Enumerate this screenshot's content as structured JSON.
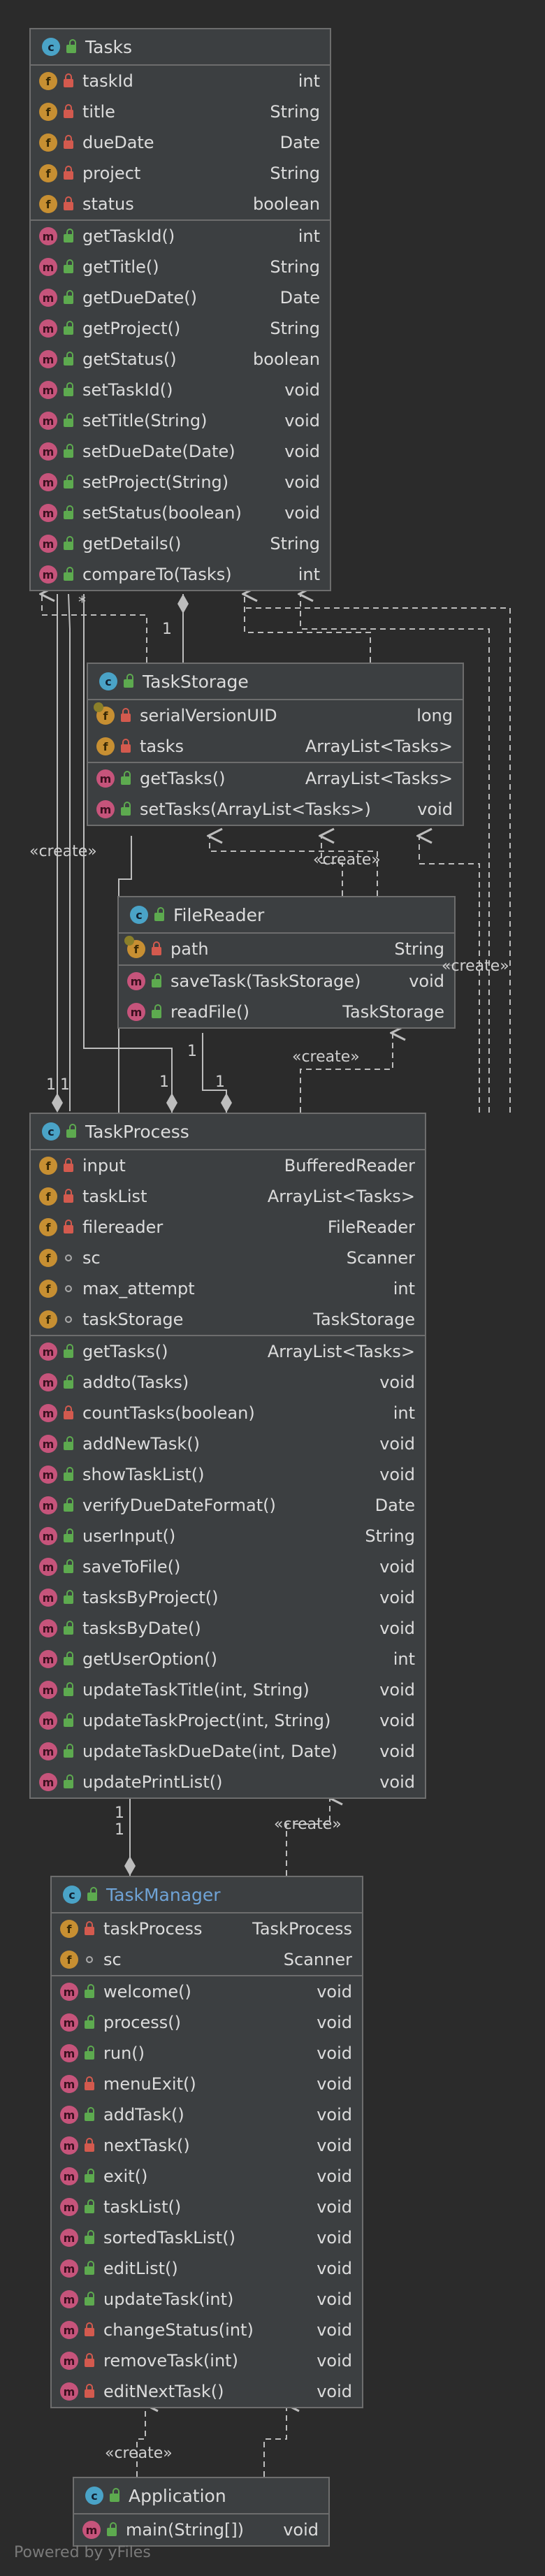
{
  "diagram": {
    "classes": [
      {
        "id": "Tasks",
        "title": "Tasks",
        "accent": false,
        "fields": [
          {
            "name": "taskId",
            "type": "int",
            "vis": "private"
          },
          {
            "name": "title",
            "type": "String",
            "vis": "private"
          },
          {
            "name": "dueDate",
            "type": "Date",
            "vis": "private"
          },
          {
            "name": "project",
            "type": "String",
            "vis": "private"
          },
          {
            "name": "status",
            "type": "boolean",
            "vis": "private"
          }
        ],
        "methods": [
          {
            "name": "getTaskId()",
            "type": "int",
            "vis": "public"
          },
          {
            "name": "getTitle()",
            "type": "String",
            "vis": "public"
          },
          {
            "name": "getDueDate()",
            "type": "Date",
            "vis": "public"
          },
          {
            "name": "getProject()",
            "type": "String",
            "vis": "public"
          },
          {
            "name": "getStatus()",
            "type": "boolean",
            "vis": "public"
          },
          {
            "name": "setTaskId()",
            "type": "void",
            "vis": "public"
          },
          {
            "name": "setTitle(String)",
            "type": "void",
            "vis": "public"
          },
          {
            "name": "setDueDate(Date)",
            "type": "void",
            "vis": "public"
          },
          {
            "name": "setProject(String)",
            "type": "void",
            "vis": "public"
          },
          {
            "name": "setStatus(boolean)",
            "type": "void",
            "vis": "public"
          },
          {
            "name": "getDetails()",
            "type": "String",
            "vis": "public"
          },
          {
            "name": "compareTo(Tasks)",
            "type": "int",
            "vis": "public"
          }
        ]
      },
      {
        "id": "TaskStorage",
        "title": "TaskStorage",
        "accent": false,
        "fields": [
          {
            "name": "serialVersionUID",
            "type": "long",
            "vis": "private",
            "serial": true
          },
          {
            "name": "tasks",
            "type": "ArrayList<Tasks>",
            "vis": "private"
          }
        ],
        "methods": [
          {
            "name": "getTasks()",
            "type": "ArrayList<Tasks>",
            "vis": "public"
          },
          {
            "name": "setTasks(ArrayList<Tasks>)",
            "type": "void",
            "vis": "public"
          }
        ]
      },
      {
        "id": "FileReader",
        "title": "FileReader",
        "accent": false,
        "fields": [
          {
            "name": "path",
            "type": "String",
            "vis": "private",
            "serial": true
          }
        ],
        "methods": [
          {
            "name": "saveTask(TaskStorage)",
            "type": "void",
            "vis": "public"
          },
          {
            "name": "readFile()",
            "type": "TaskStorage",
            "vis": "public"
          }
        ]
      },
      {
        "id": "TaskProcess",
        "title": "TaskProcess",
        "accent": false,
        "fields": [
          {
            "name": "input",
            "type": "BufferedReader",
            "vis": "private"
          },
          {
            "name": "taskList",
            "type": "ArrayList<Tasks>",
            "vis": "private"
          },
          {
            "name": "filereader",
            "type": "FileReader",
            "vis": "private"
          },
          {
            "name": "sc",
            "type": "Scanner",
            "vis": "package"
          },
          {
            "name": "max_attempt",
            "type": "int",
            "vis": "package"
          },
          {
            "name": "taskStorage",
            "type": "TaskStorage",
            "vis": "package"
          }
        ],
        "methods": [
          {
            "name": "getTasks()",
            "type": "ArrayList<Tasks>",
            "vis": "public"
          },
          {
            "name": "addto(Tasks)",
            "type": "void",
            "vis": "public"
          },
          {
            "name": "countTasks(boolean)",
            "type": "int",
            "vis": "private"
          },
          {
            "name": "addNewTask()",
            "type": "void",
            "vis": "public"
          },
          {
            "name": "showTaskList()",
            "type": "void",
            "vis": "public"
          },
          {
            "name": "verifyDueDateFormat()",
            "type": "Date",
            "vis": "public"
          },
          {
            "name": "userInput()",
            "type": "String",
            "vis": "public"
          },
          {
            "name": "saveToFile()",
            "type": "void",
            "vis": "public"
          },
          {
            "name": "tasksByProject()",
            "type": "void",
            "vis": "public"
          },
          {
            "name": "tasksByDate()",
            "type": "void",
            "vis": "public"
          },
          {
            "name": "getUserOption()",
            "type": "int",
            "vis": "public"
          },
          {
            "name": "updateTaskTitle(int, String)",
            "type": "void",
            "vis": "public"
          },
          {
            "name": "updateTaskProject(int, String)",
            "type": "void",
            "vis": "public"
          },
          {
            "name": "updateTaskDueDate(int, Date)",
            "type": "void",
            "vis": "public"
          },
          {
            "name": "updatePrintList()",
            "type": "void",
            "vis": "public"
          }
        ]
      },
      {
        "id": "TaskManager",
        "title": "TaskManager",
        "accent": true,
        "fields": [
          {
            "name": "taskProcess",
            "type": "TaskProcess",
            "vis": "private"
          },
          {
            "name": "sc",
            "type": "Scanner",
            "vis": "package"
          }
        ],
        "methods": [
          {
            "name": "welcome()",
            "type": "void",
            "vis": "public"
          },
          {
            "name": "process()",
            "type": "void",
            "vis": "public"
          },
          {
            "name": "run()",
            "type": "void",
            "vis": "public"
          },
          {
            "name": "menuExit()",
            "type": "void",
            "vis": "private"
          },
          {
            "name": "addTask()",
            "type": "void",
            "vis": "public"
          },
          {
            "name": "nextTask()",
            "type": "void",
            "vis": "private"
          },
          {
            "name": "exit()",
            "type": "void",
            "vis": "public"
          },
          {
            "name": "taskList()",
            "type": "void",
            "vis": "public"
          },
          {
            "name": "sortedTaskList()",
            "type": "void",
            "vis": "public"
          },
          {
            "name": "editList()",
            "type": "void",
            "vis": "public"
          },
          {
            "name": "updateTask(int)",
            "type": "void",
            "vis": "public"
          },
          {
            "name": "changeStatus(int)",
            "type": "void",
            "vis": "private"
          },
          {
            "name": "removeTask(int)",
            "type": "void",
            "vis": "private"
          },
          {
            "name": "editNextTask()",
            "type": "void",
            "vis": "private"
          }
        ]
      },
      {
        "id": "Application",
        "title": "Application",
        "accent": false,
        "fields": [],
        "methods": [
          {
            "name": "main(String[])",
            "type": "void",
            "vis": "public"
          }
        ]
      }
    ],
    "edge_labels": {
      "create_1": "«create»",
      "create_2": "«create»",
      "create_3": "«create»",
      "create_4": "«create»",
      "create_5": "«create»",
      "create_6": "«create»",
      "m_tasks_storage_1": "1",
      "m_tasks_storage_star": "*",
      "m_tasks_process_1": "1",
      "m_tasks_process_1b": "1",
      "m_storage_process_1": "1",
      "m_filereader_process_1": "1",
      "m_filereader_process_1b": "1",
      "m_process_manager_1": "1",
      "m_process_manager_1b": "1"
    },
    "watermark": "Powered by yFiles",
    "colors": {
      "background": "#2b2b2b",
      "class_fill": "#3c3f41",
      "border": "#6d6d6d",
      "class_badge": "#4aa3c7",
      "field_badge": "#c78f32",
      "method_badge": "#c6547b",
      "private_icon": "#d35a4e",
      "public_icon": "#5daa4f",
      "accent_title": "#6fa3d6"
    }
  }
}
